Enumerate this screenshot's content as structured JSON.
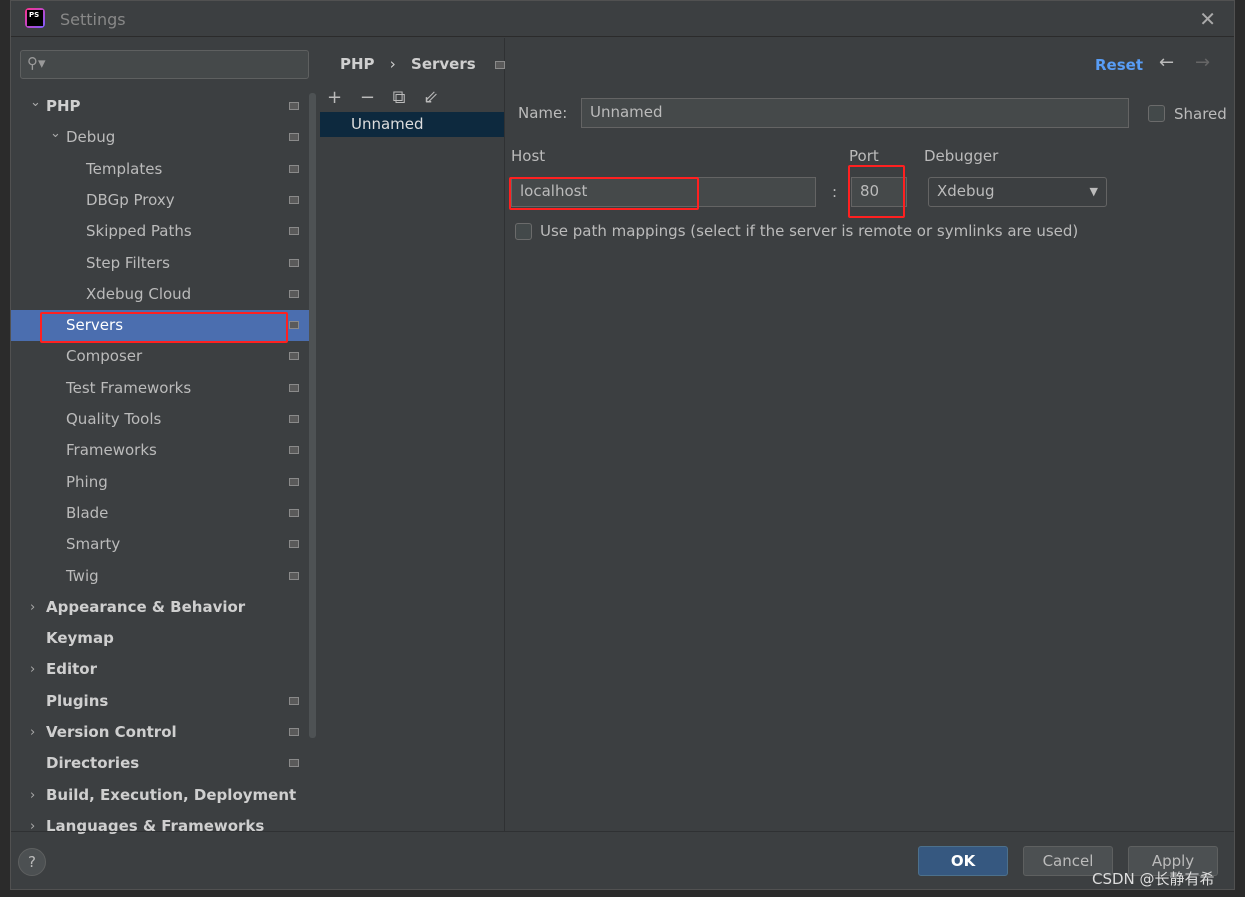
{
  "window": {
    "title": "Settings",
    "logo_text": "PS"
  },
  "sidebar": {
    "search_placeholder": "",
    "items": [
      {
        "label": "PHP",
        "level": 0,
        "expanded": true,
        "bold": true
      },
      {
        "label": "Debug",
        "level": 1,
        "expanded": true
      },
      {
        "label": "Templates",
        "level": 2
      },
      {
        "label": "DBGp Proxy",
        "level": 2
      },
      {
        "label": "Skipped Paths",
        "level": 2
      },
      {
        "label": "Step Filters",
        "level": 2
      },
      {
        "label": "Xdebug Cloud",
        "level": 2
      },
      {
        "label": "Servers",
        "level": 1,
        "selected": true
      },
      {
        "label": "Composer",
        "level": 1
      },
      {
        "label": "Test Frameworks",
        "level": 1
      },
      {
        "label": "Quality Tools",
        "level": 1
      },
      {
        "label": "Frameworks",
        "level": 1
      },
      {
        "label": "Phing",
        "level": 1
      },
      {
        "label": "Blade",
        "level": 1
      },
      {
        "label": "Smarty",
        "level": 1
      },
      {
        "label": "Twig",
        "level": 1
      },
      {
        "label": "Appearance & Behavior",
        "level": 0,
        "collapsed": true,
        "bold": true
      },
      {
        "label": "Keymap",
        "level": 0,
        "bold": true
      },
      {
        "label": "Editor",
        "level": 0,
        "collapsed": true,
        "bold": true
      },
      {
        "label": "Plugins",
        "level": 0,
        "bold": true
      },
      {
        "label": "Version Control",
        "level": 0,
        "collapsed": true,
        "bold": true
      },
      {
        "label": "Directories",
        "level": 0,
        "bold": true
      },
      {
        "label": "Build, Execution, Deployment",
        "level": 0,
        "collapsed": true,
        "bold": true
      },
      {
        "label": "Languages & Frameworks",
        "level": 0,
        "collapsed": true,
        "bold": true
      }
    ]
  },
  "breadcrumb": {
    "parent": "PHP",
    "sep": "›",
    "current": "Servers"
  },
  "header": {
    "reset": "Reset",
    "back": "←",
    "forward": "→"
  },
  "servers": {
    "toolbar": [
      "+",
      "−",
      "⧉",
      "⇙"
    ],
    "list": [
      "Unnamed"
    ]
  },
  "form": {
    "name_label": "Name:",
    "name_value": "Unnamed",
    "shared_label": "Shared",
    "shared_checked": false,
    "host_label": "Host",
    "host_value": "localhost",
    "colon": ":",
    "port_label": "Port",
    "port_value": "80",
    "debugger_label": "Debugger",
    "debugger_value": "Xdebug",
    "path_mappings_label": "Use path mappings (select if the server is remote or symlinks are used)",
    "path_mappings_checked": false
  },
  "footer": {
    "help": "?",
    "ok": "OK",
    "cancel": "Cancel",
    "apply": "Apply"
  },
  "watermark": "CSDN @长静有希",
  "colors": {
    "accent": "#589df6",
    "selection": "#4b6eaf",
    "highlight": "#ff2020"
  }
}
